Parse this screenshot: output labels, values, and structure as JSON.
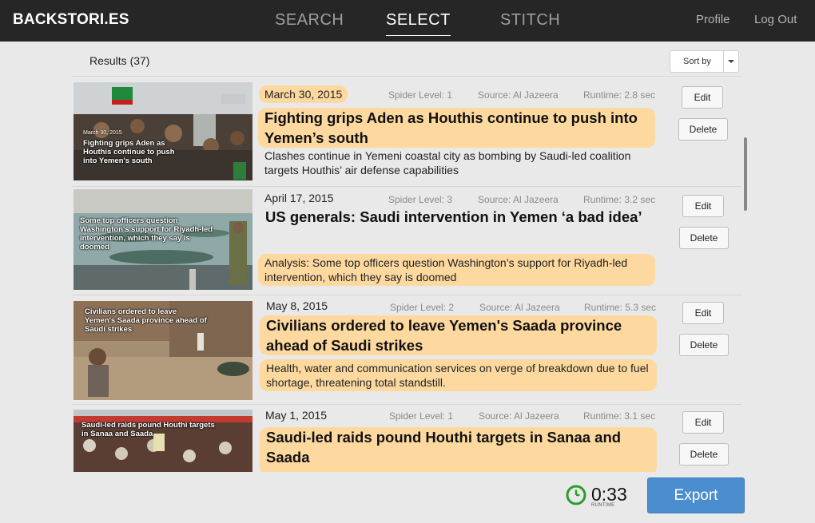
{
  "header": {
    "brand": "BACKSTORI.ES",
    "nav": [
      "SEARCH",
      "SELECT",
      "STITCH"
    ],
    "active_nav": "SELECT",
    "profile": "Profile",
    "logout": "Log Out"
  },
  "results": {
    "label": "Results (37)",
    "sort_label": "Sort by"
  },
  "meta_labels": {
    "spider": "Spider Level:",
    "source": "Source:",
    "runtime": "Runtime:"
  },
  "articles": [
    {
      "date": "March 30, 2015",
      "spider": "Spider Level: 1",
      "source": "Source: Al Jazeera",
      "runtime": "Runtime: 2.8 sec",
      "title": "Fighting grips Aden as Houthis continue to push into Yemen’s south",
      "summary": "Clashes continue in Yemeni coastal city as bombing by Saudi-led coalition targets Houthis’ air defense capabilities",
      "thumb_date": "March 30, 2015",
      "thumb_caption": "Fighting grips Aden as Houthis continue to push into Yemen's south",
      "edit": "Edit",
      "delete": "Delete"
    },
    {
      "date": "April 17, 2015",
      "spider": "Spider Level: 3",
      "source": "Source: Al Jazeera",
      "runtime": "Runtime: 3.2 sec",
      "title": "US generals: Saudi intervention in Yemen ‘a bad idea’",
      "summary": "Analysis: Some top officers question Washington’s support for Riyadh-led intervention, which they say is doomed",
      "thumb_caption": "Some top officers question Washington's support for Riyadh-led intervention, which they say is doomed",
      "edit": "Edit",
      "delete": "Delete"
    },
    {
      "date": "May 8, 2015",
      "spider": "Spider Level: 2",
      "source": "Source: Al Jazeera",
      "runtime": "Runtime: 5.3 sec",
      "title": "Civilians ordered to leave Yemen's Saada province ahead of Saudi strikes",
      "summary": "Health, water and communication services on verge of breakdown due to fuel shortage, threatening total standstill.",
      "thumb_caption": "Civilians ordered to leave Yemen's Saada province ahead of Saudi strikes",
      "edit": "Edit",
      "delete": "Delete"
    },
    {
      "date": "May 1, 2015",
      "spider": "Spider Level: 1",
      "source": "Source: Al Jazeera",
      "runtime": "Runtime: 3.1 sec",
      "title": "Saudi-led raids pound Houthi targets in Sanaa and Saada",
      "summary": "",
      "thumb_caption": "Saudi-led raids pound Houthi targets in Sanaa and Saada",
      "edit": "Edit",
      "delete": "Delete"
    }
  ],
  "footer": {
    "runtime_value": "0:33",
    "runtime_label": "RUNTIME",
    "export": "Export"
  },
  "colors": {
    "topbar": "#262626",
    "highlight": "#fdd9a0",
    "export": "#4a8ed0",
    "clock": "#2a9d2a"
  }
}
